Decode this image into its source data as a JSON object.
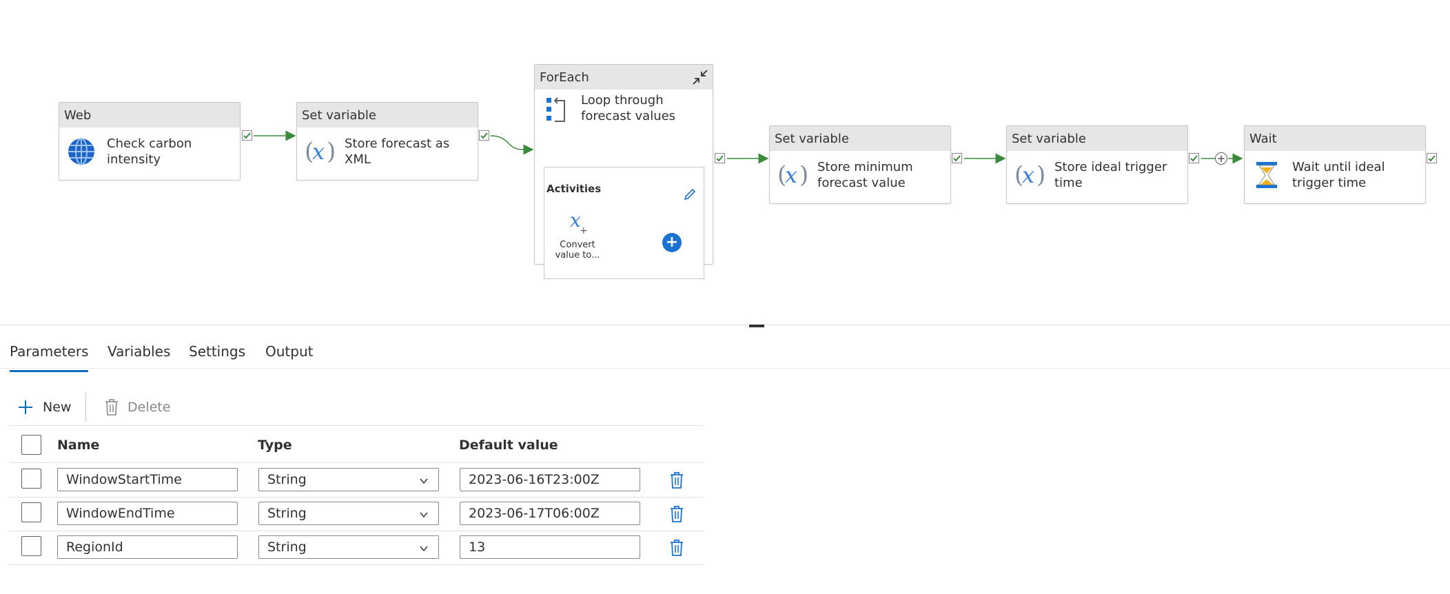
{
  "pipeline": {
    "activities": [
      {
        "type": "Web",
        "label": "Check carbon intensity",
        "icon": "globe-icon"
      },
      {
        "type": "Set variable",
        "label": "Store forecast as XML",
        "icon": "variable-icon"
      },
      {
        "type": "ForEach",
        "label": "Loop through forecast values",
        "icon": "foreach-icon",
        "inner": {
          "title": "Activities",
          "activity_caption": "Convert value to...",
          "add": "+"
        }
      },
      {
        "type": "Set variable",
        "label": "Store minimum forecast value",
        "icon": "variable-icon"
      },
      {
        "type": "Set variable",
        "label": "Store ideal trigger time",
        "icon": "variable-icon"
      },
      {
        "type": "Wait",
        "label": "Wait until ideal trigger time",
        "icon": "hourglass-icon"
      }
    ],
    "connector_add": "+"
  },
  "colors": {
    "accent": "#0f6cbd",
    "success": "#3c8a3c",
    "delete": "#1a73d1",
    "header_bg": "#e6e6e6"
  },
  "tabs": [
    "Parameters",
    "Variables",
    "Settings",
    "Output"
  ],
  "active_tab": "Parameters",
  "toolbar": {
    "new_label": "New",
    "delete_label": "Delete"
  },
  "table": {
    "columns": [
      "Name",
      "Type",
      "Default value"
    ],
    "rows": [
      {
        "name": "WindowStartTime",
        "type": "String",
        "default": "2023-06-16T23:00Z"
      },
      {
        "name": "WindowEndTime",
        "type": "String",
        "default": "2023-06-17T06:00Z"
      },
      {
        "name": "RegionId",
        "type": "String",
        "default": "13"
      }
    ]
  }
}
